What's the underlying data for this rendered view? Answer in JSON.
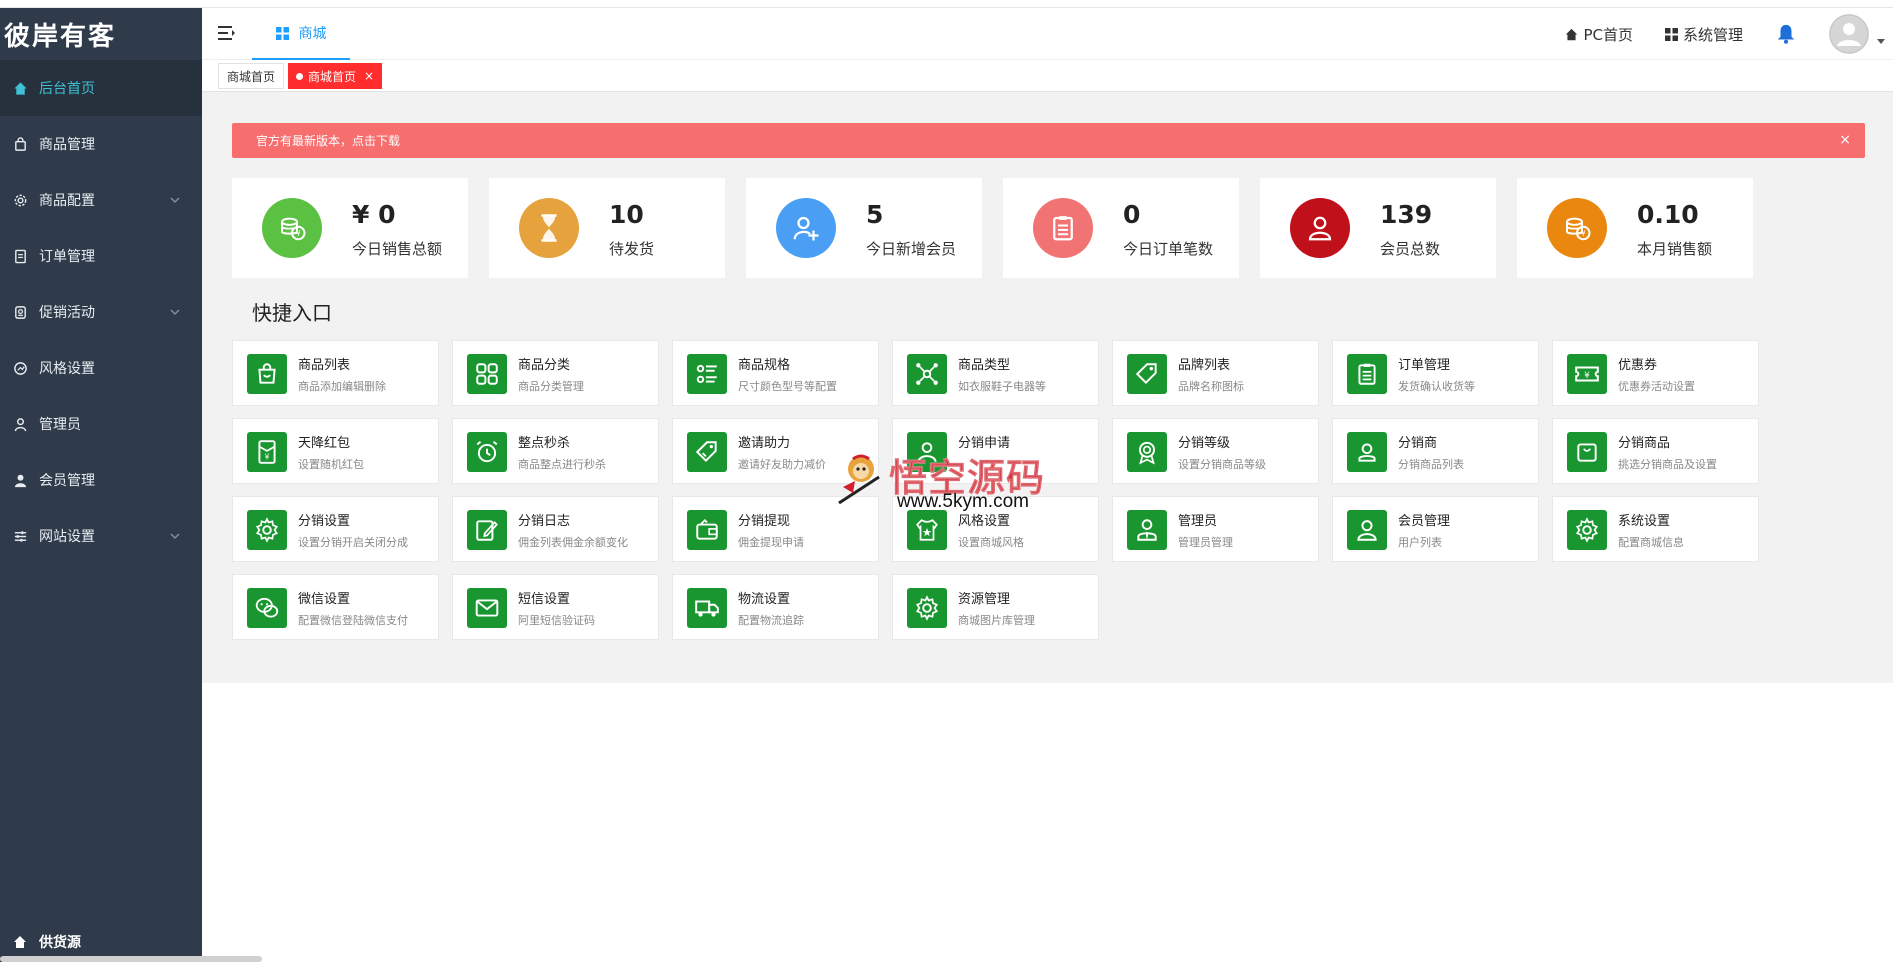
{
  "brand": "彼岸有客",
  "sidebar": {
    "items": [
      {
        "label": "后台首页",
        "icon": "home-icon",
        "active": true,
        "has_children": false
      },
      {
        "label": "商品管理",
        "icon": "bag-icon",
        "active": false,
        "has_children": false
      },
      {
        "label": "商品配置",
        "icon": "gear-icon",
        "active": false,
        "has_children": true
      },
      {
        "label": "订单管理",
        "icon": "document-icon",
        "active": false,
        "has_children": false
      },
      {
        "label": "促销活动",
        "icon": "badge-icon",
        "active": false,
        "has_children": true
      },
      {
        "label": "风格设置",
        "icon": "gauge-icon",
        "active": false,
        "has_children": false
      },
      {
        "label": "管理员",
        "icon": "user-outline-icon",
        "active": false,
        "has_children": false
      },
      {
        "label": "会员管理",
        "icon": "user-filled-icon",
        "active": false,
        "has_children": false
      },
      {
        "label": "网站设置",
        "icon": "sliders-icon",
        "active": false,
        "has_children": true
      }
    ],
    "bottom_item": "供货源"
  },
  "header": {
    "tab_label": "商城",
    "pc_home": "PC首页",
    "system_manage": "系统管理"
  },
  "page_tabs": {
    "home": "商城首页",
    "current": "商城首页",
    "close": "×"
  },
  "notice": {
    "text": "官方有最新版本，点击下载",
    "close": "×"
  },
  "stats": [
    {
      "value": "¥ 0",
      "label": "今日销售总额",
      "color": "#5bc142",
      "icon": "coins-icon"
    },
    {
      "value": "10",
      "label": "待发货",
      "color": "#e5a23d",
      "icon": "hourglass-icon"
    },
    {
      "value": "5",
      "label": "今日新增会员",
      "color": "#4a9ff5",
      "icon": "add-user-icon"
    },
    {
      "value": "0",
      "label": "今日订单笔数",
      "color": "#f27373",
      "icon": "clipboard-icon"
    },
    {
      "value": "139",
      "label": "会员总数",
      "color": "#c0101a",
      "icon": "user-icon"
    },
    {
      "value": "0.10",
      "label": "本月销售额",
      "color": "#e9870e",
      "icon": "coins-icon"
    }
  ],
  "quick_title": "快捷入口",
  "quick_links": [
    {
      "title": "商品列表",
      "sub": "商品添加编辑删除",
      "icon": "shopping-bag-icon"
    },
    {
      "title": "商品分类",
      "sub": "商品分类管理",
      "icon": "category-icon"
    },
    {
      "title": "商品规格",
      "sub": "尺寸颜色型号等配置",
      "icon": "list-icon"
    },
    {
      "title": "商品类型",
      "sub": "如衣服鞋子电器等",
      "icon": "network-icon"
    },
    {
      "title": "品牌列表",
      "sub": "品牌名称图标",
      "icon": "tag-icon"
    },
    {
      "title": "订单管理",
      "sub": "发货确认收货等",
      "icon": "clipboard-icon"
    },
    {
      "title": "优惠券",
      "sub": "优惠券活动设置",
      "icon": "coupon-icon"
    },
    {
      "title": "天降红包",
      "sub": "设置随机红包",
      "icon": "red-envelope-icon"
    },
    {
      "title": "整点秒杀",
      "sub": "商品整点进行秒杀",
      "icon": "alarm-icon"
    },
    {
      "title": "邀请助力",
      "sub": "邀请好友助力减价",
      "icon": "price-tag-icon"
    },
    {
      "title": "分销申请",
      "sub": "",
      "icon": "user-check-icon"
    },
    {
      "title": "分销等级",
      "sub": "设置分销商品等级",
      "icon": "medal-icon"
    },
    {
      "title": "分销商",
      "sub": "分销商品列表",
      "icon": "user-outline-icon"
    },
    {
      "title": "分销商品",
      "sub": "挑选分销商品及设置",
      "icon": "bag-icon"
    },
    {
      "title": "分销设置",
      "sub": "设置分销开启关闭分成",
      "icon": "gear-icon"
    },
    {
      "title": "分销日志",
      "sub": "佣金列表佣金余额变化",
      "icon": "edit-icon"
    },
    {
      "title": "分销提现",
      "sub": "佣金提现申请",
      "icon": "wallet-icon"
    },
    {
      "title": "风格设置",
      "sub": "设置商城风格",
      "icon": "star-shirt-icon"
    },
    {
      "title": "管理员",
      "sub": "管理员管理",
      "icon": "admin-icon"
    },
    {
      "title": "会员管理",
      "sub": "用户列表",
      "icon": "user-icon"
    },
    {
      "title": "系统设置",
      "sub": "配置商城信息",
      "icon": "gear-icon"
    },
    {
      "title": "微信设置",
      "sub": "配置微信登陆微信支付",
      "icon": "wechat-icon"
    },
    {
      "title": "短信设置",
      "sub": "阿里短信验证码",
      "icon": "mail-icon"
    },
    {
      "title": "物流设置",
      "sub": "配置物流追踪",
      "icon": "truck-icon"
    },
    {
      "title": "资源管理",
      "sub": "商城图片库管理",
      "icon": "gear-icon"
    }
  ],
  "watermark": {
    "title": "悟空源码",
    "url": "www.5kym.com"
  }
}
